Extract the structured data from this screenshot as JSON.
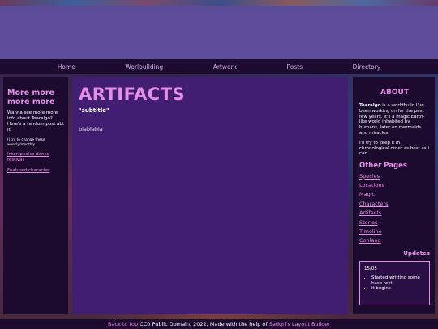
{
  "nav": {
    "items": [
      "Home",
      "Worlbuilding",
      "Artwork",
      "Posts",
      "Directory"
    ]
  },
  "left": {
    "title": "More more more more",
    "text": "Wanna see more more info about Tearalgo? Here's a random post abt it!",
    "small": "(I try to change these weekly/monthly",
    "links": [
      "Interspecies dance festival",
      "Featured character"
    ]
  },
  "main": {
    "title": "ARTIFACTS",
    "subtitle": "\"subtitle\"",
    "body": "blablabla"
  },
  "right": {
    "about_title": "ABOUT",
    "about_bold": "Tearalgo",
    "about_text": " is a worldbuild I've been working on for the past few years. It's a magic Earth-like world inhabited by humans, later on mermaids and miracles.",
    "about_text2": "I'll try to keep it in chronological order as best as i can.",
    "other_title": "Other Pages",
    "pages": [
      "Species",
      "Locations",
      "Magic",
      "Characters",
      "Artifacts",
      "Stories",
      "Timeline",
      "Conlang"
    ],
    "updates_title": "Updates",
    "update_date": "15/05",
    "update_items": [
      "Started writting some base text",
      "it begins"
    ]
  },
  "footer": {
    "back_to_top": "Back to top",
    "text": " CC0 Public Domain, 2022; Made with the help of ",
    "builder": "Sadgrl's Layout Builder"
  },
  "colors": {
    "accent": "#e58ee6",
    "header": "#5e4d9a",
    "panel_dark": "#1c0b2e",
    "panel_main": "#421e72"
  }
}
